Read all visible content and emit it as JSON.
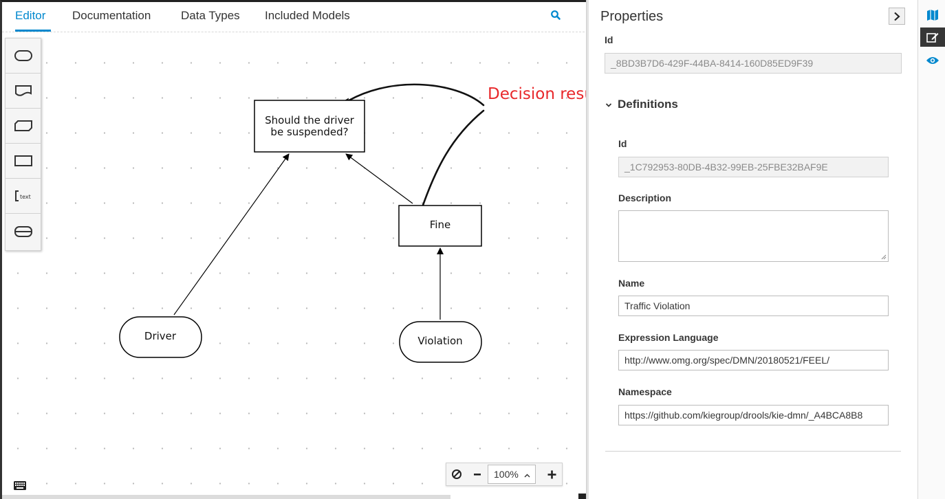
{
  "editor": {
    "tabs": [
      "Editor",
      "Documentation",
      "Data Types",
      "Included Models"
    ],
    "active_tab": "Editor"
  },
  "diagram": {
    "nodes": {
      "suspend": [
        "Should the driver",
        "be suspended?"
      ],
      "fine": "Fine",
      "driver": "Driver",
      "violation": "Violation"
    },
    "annotation": "Decision results"
  },
  "zoom": {
    "level": "100%"
  },
  "properties": {
    "title": "Properties",
    "id_label": "Id",
    "id_value": "_8BD3B7D6-429F-44BA-8414-160D85ED9F39",
    "section_label": "Definitions",
    "def_id_label": "Id",
    "def_id_value": "_1C792953-80DB-4B32-99EB-25FBE32BAF9E",
    "description_label": "Description",
    "description_value": "",
    "name_label": "Name",
    "name_value": "Traffic Violation",
    "expr_label": "Expression Language",
    "expr_value": "http://www.omg.org/spec/DMN/20180521/FEEL/",
    "namespace_label": "Namespace",
    "namespace_value": "https://github.com/kiegroup/drools/kie-dmn/_A4BCA8B8"
  },
  "colors": {
    "accent": "#0088ce",
    "annotation": "#e8282b",
    "rail_active": "#363636"
  },
  "icons": {
    "search": "search-icon",
    "collapse": "chevron-right-icon",
    "rail": [
      "map-icon",
      "edit-icon",
      "eye-icon"
    ],
    "palette": [
      "input-data-icon",
      "knowledge-source-icon",
      "bkm-icon",
      "decision-icon",
      "text-annotation-icon",
      "decision-service-icon"
    ],
    "zoom": [
      "reset-icon",
      "minus-icon",
      "chevron-up-icon",
      "plus-icon"
    ],
    "keyboard": "keyboard-icon"
  }
}
